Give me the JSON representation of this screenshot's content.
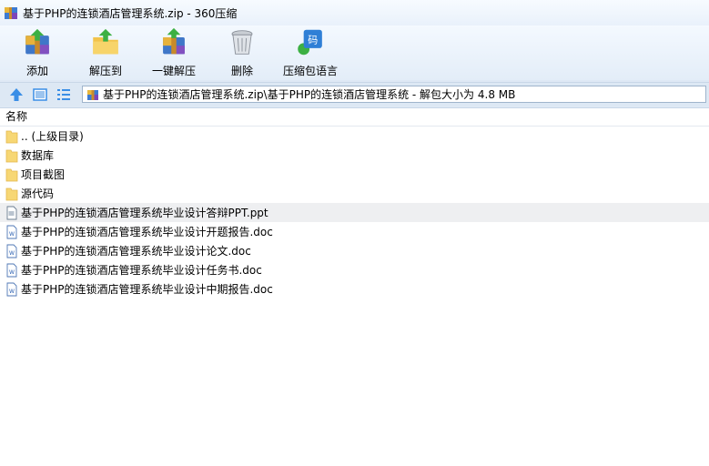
{
  "window": {
    "title": "基于PHP的连锁酒店管理系统.zip - 360压缩"
  },
  "toolbar": {
    "add": "添加",
    "extract_to": "解压到",
    "one_click_extract": "一键解压",
    "delete": "删除",
    "archive_language": "压缩包语言"
  },
  "nav": {
    "path": "基于PHP的连锁酒店管理系统.zip\\基于PHP的连锁酒店管理系统 - 解包大小为 4.8 MB"
  },
  "list": {
    "column_name": "名称",
    "items": [
      {
        "label": ".. (上级目录)",
        "type": "folder"
      },
      {
        "label": "数据库",
        "type": "folder"
      },
      {
        "label": "项目截图",
        "type": "folder"
      },
      {
        "label": "源代码",
        "type": "folder"
      },
      {
        "label": "基于PHP的连锁酒店管理系统毕业设计答辩PPT.ppt",
        "type": "ppt"
      },
      {
        "label": "基于PHP的连锁酒店管理系统毕业设计开题报告.doc",
        "type": "doc"
      },
      {
        "label": "基于PHP的连锁酒店管理系统毕业设计论文.doc",
        "type": "doc"
      },
      {
        "label": "基于PHP的连锁酒店管理系统毕业设计任务书.doc",
        "type": "doc"
      },
      {
        "label": "基于PHP的连锁酒店管理系统毕业设计中期报告.doc",
        "type": "doc"
      }
    ]
  },
  "colors": {
    "accent": "#3a8ee6",
    "folder": "#f7d774",
    "highlight_row": "#eeeff1"
  }
}
